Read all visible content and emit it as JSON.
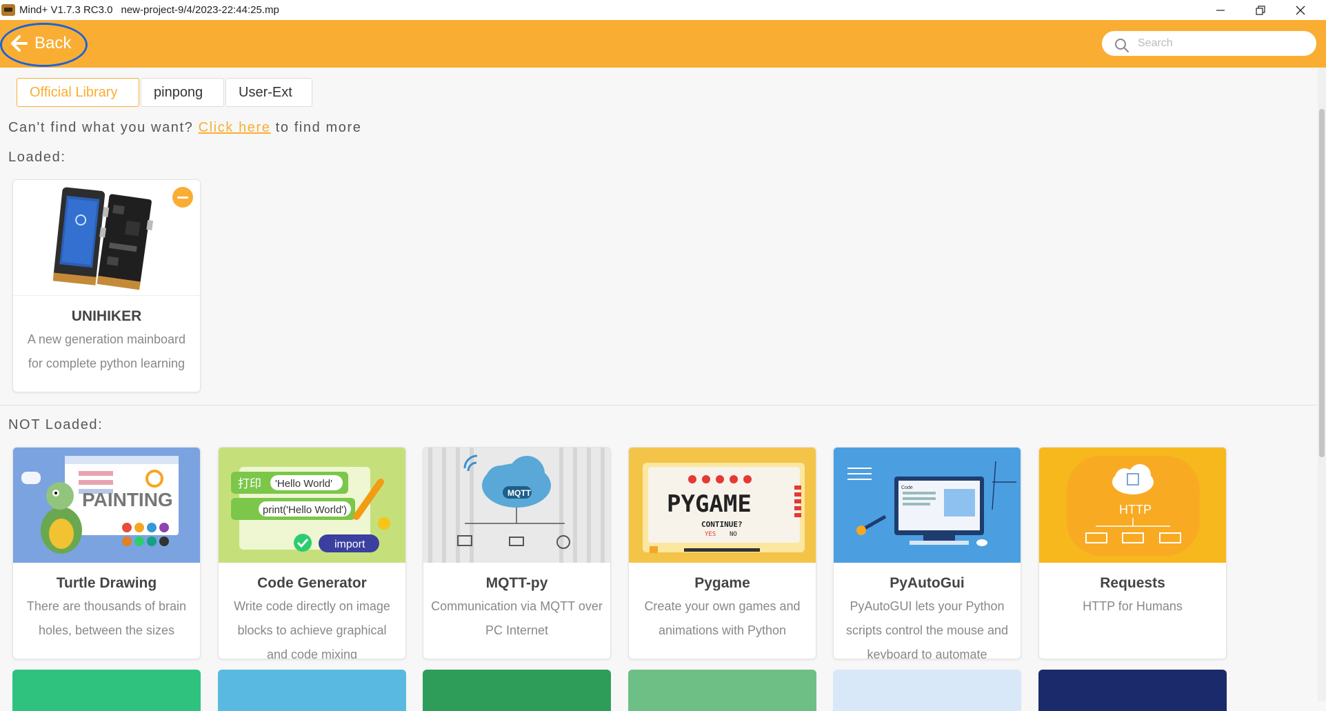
{
  "window": {
    "app": "Mind+ V1.7.3 RC3.0",
    "file": "new-project-9/4/2023-22:44:25.mp"
  },
  "header": {
    "back_label": "Back",
    "search_placeholder": "Search",
    "accent_color": "#f9ae33"
  },
  "tabs": [
    {
      "label": "Official Library",
      "active": true
    },
    {
      "label": "pinpong",
      "active": false
    },
    {
      "label": "User-Ext",
      "active": false
    }
  ],
  "hint": {
    "before": "Can't find what you want?",
    "link": "Click here",
    "after": "to find more"
  },
  "loaded_label": "Loaded:",
  "not_loaded_label": "NOT Loaded:",
  "loaded": [
    {
      "name": "UNIHIKER",
      "desc": "A new generation mainboard for complete python learning",
      "icon": "unihiker-board-image"
    }
  ],
  "not_loaded": [
    {
      "name": "Turtle Drawing",
      "desc": "There are thousands of brain holes, between the sizes",
      "icon": "turtle-painting-image",
      "image_text": "PAINTING"
    },
    {
      "name": "Code Generator",
      "desc": "Write code directly on image blocks to achieve graphical and code mixing",
      "icon": "code-generator-image",
      "image_text": [
        "打印",
        "'Hello World'",
        "print('Hello World')",
        "import"
      ]
    },
    {
      "name": "MQTT-py",
      "desc": "Communication via MQTT over PC Internet",
      "icon": "mqtt-cloud-image",
      "image_text": "MQTT"
    },
    {
      "name": "Pygame",
      "desc": "Create your own games and animations with Python",
      "icon": "pygame-image",
      "image_text": [
        "PYGAME",
        "CONTINUE?",
        "YES",
        "NO"
      ]
    },
    {
      "name": "PyAutoGui",
      "desc": "PyAutoGUI lets your Python scripts control the mouse and keyboard to automate",
      "icon": "pyautogui-image",
      "image_text": "Code"
    },
    {
      "name": "Requests",
      "desc": "HTTP for Humans",
      "icon": "http-cloud-image",
      "image_text": "HTTP"
    }
  ]
}
